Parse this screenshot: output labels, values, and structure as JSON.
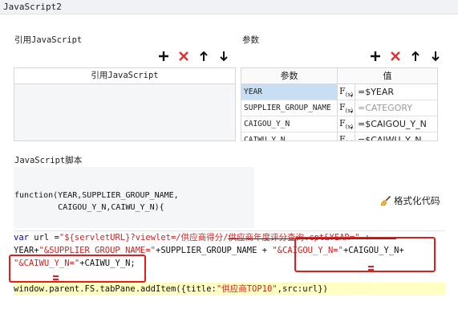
{
  "window": {
    "title": "JavaScript2"
  },
  "references": {
    "section_label": "引用JavaScript",
    "column_header": "引用JavaScript",
    "toolbar": {
      "add_icon": "plus-icon",
      "delete_icon": "x-icon",
      "up_icon": "arrow-up-icon",
      "down_icon": "arrow-down-icon"
    }
  },
  "params": {
    "section_label": "参数",
    "headers": {
      "name": "参数",
      "value": "值"
    },
    "fx_label": "F",
    "fx_sub": "(x)",
    "fx_arrow": "▾",
    "rows": [
      {
        "name": "YEAR",
        "value": "=$YEAR",
        "selected": true,
        "muted": false
      },
      {
        "name": "SUPPLIER_GROUP_NAME",
        "value": "=CATEGORY",
        "selected": false,
        "muted": true
      },
      {
        "name": "CAIGOU_Y_N",
        "value": "=$CAIGOU_Y_N",
        "selected": false,
        "muted": false
      },
      {
        "name": "CAIWU_Y_N",
        "value": "=$CAIWU_Y_N",
        "selected": false,
        "muted": false
      }
    ]
  },
  "script": {
    "section_label": "JavaScript脚本",
    "function_signature_line1": "function(YEAR,SUPPLIER_GROUP_NAME,",
    "function_signature_line2": "         CAIGOU_Y_N,CAIWU_Y_N){",
    "format_button_label": "格式化代码",
    "code": {
      "l1_kw": "var",
      "l1_plain": " url =",
      "l1_str1": "\"${servletURL}?viewlet=/供应商得分/供应商年度评分查询.cpt&YEAR=\"",
      "l1_plain2": " +",
      "l2_plain": "YEAR+",
      "l2_str1": "\"&SUPPLIER_GROUP_NAME=\"",
      "l2_plain2": "+SUPPLIER_GROUP_NAME + ",
      "l2_str2": "\"&CAIGOU_Y_N=\"",
      "l2_plain3": "+CAIGOU_Y_N+",
      "l3_str1": "\"&CAIWU_Y_N=\"",
      "l3_plain": "+CAIWU_Y_N;",
      "l4_plain1": "window.parent.FS.tabPane.addItem({title:",
      "l4_str": "\"供应商TOP10\"",
      "l4_plain2": ",src:url})"
    }
  },
  "colors": {
    "annotation": "#ea1a1a",
    "delete": "#e03030",
    "highlight": "#ffffc4",
    "keyword": "#0000c8",
    "string": "#d81e1e"
  }
}
